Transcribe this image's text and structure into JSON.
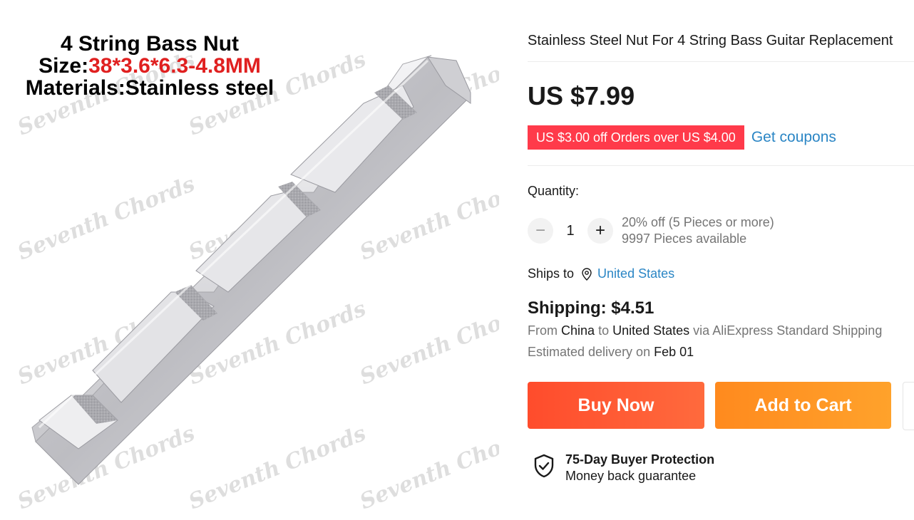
{
  "image": {
    "spec_line1": "4 String Bass Nut",
    "spec_size_label": "Size:",
    "spec_size_value": "38*3.6*6.3-4.8MM",
    "spec_materials": "Materials:Stainless steel",
    "watermark_text": "Seventh Chords"
  },
  "product": {
    "title": "Stainless Steel Nut For 4 String Bass Guitar Replacement",
    "price": "US $7.99",
    "coupon_text": "US $3.00 off Orders over US $4.00",
    "get_coupons": "Get coupons"
  },
  "quantity": {
    "label": "Quantity:",
    "minus": "−",
    "value": "1",
    "plus": "+",
    "discount": "20% off (5 Pieces or more)",
    "available": "9997 Pieces available"
  },
  "shipping": {
    "ships_to_label": "Ships to",
    "ships_to_country": "United States",
    "price": "Shipping: $4.51",
    "from_prefix": "From",
    "from_country": "China",
    "to_word": "to",
    "to_country": "United States",
    "via_text": "via AliExpress Standard Shipping",
    "delivery_prefix": "Estimated delivery on",
    "delivery_date": "Feb 01"
  },
  "actions": {
    "buy_now": "Buy Now",
    "add_to_cart": "Add to Cart"
  },
  "protection": {
    "title": "75-Day Buyer Protection",
    "subtitle": "Money back guarantee"
  },
  "colors": {
    "price_text": "#191919",
    "coupon_bg": "#ff3a4a",
    "link_blue": "#2b86c5",
    "buy_now": "#ff4c2c",
    "add_to_cart": "#ff9a26"
  }
}
